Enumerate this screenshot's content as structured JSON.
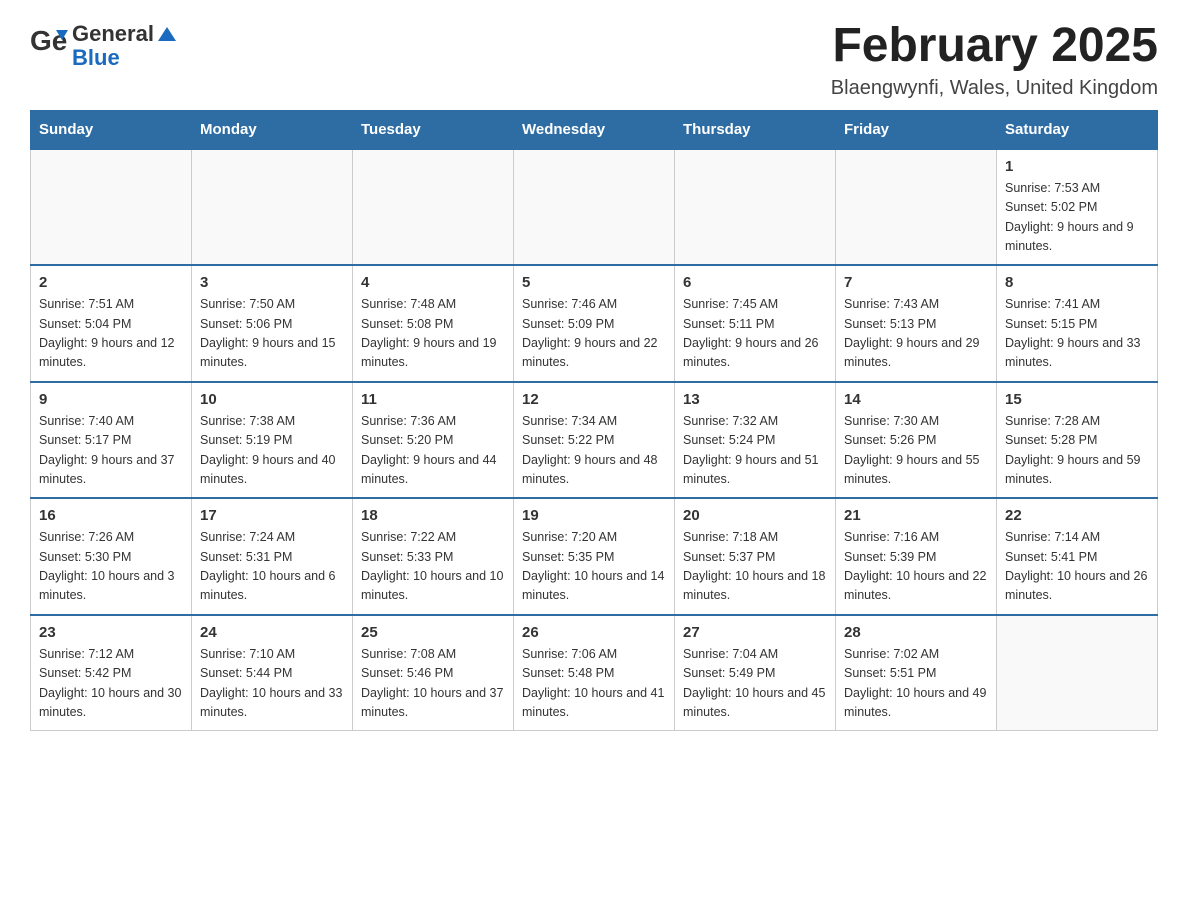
{
  "header": {
    "logo_general": "General",
    "logo_blue": "Blue",
    "month_title": "February 2025",
    "location": "Blaengwynfi, Wales, United Kingdom"
  },
  "weekdays": [
    "Sunday",
    "Monday",
    "Tuesday",
    "Wednesday",
    "Thursday",
    "Friday",
    "Saturday"
  ],
  "weeks": [
    [
      {
        "day": "",
        "sunrise": "",
        "sunset": "",
        "daylight": ""
      },
      {
        "day": "",
        "sunrise": "",
        "sunset": "",
        "daylight": ""
      },
      {
        "day": "",
        "sunrise": "",
        "sunset": "",
        "daylight": ""
      },
      {
        "day": "",
        "sunrise": "",
        "sunset": "",
        "daylight": ""
      },
      {
        "day": "",
        "sunrise": "",
        "sunset": "",
        "daylight": ""
      },
      {
        "day": "",
        "sunrise": "",
        "sunset": "",
        "daylight": ""
      },
      {
        "day": "1",
        "sunrise": "Sunrise: 7:53 AM",
        "sunset": "Sunset: 5:02 PM",
        "daylight": "Daylight: 9 hours and 9 minutes."
      }
    ],
    [
      {
        "day": "2",
        "sunrise": "Sunrise: 7:51 AM",
        "sunset": "Sunset: 5:04 PM",
        "daylight": "Daylight: 9 hours and 12 minutes."
      },
      {
        "day": "3",
        "sunrise": "Sunrise: 7:50 AM",
        "sunset": "Sunset: 5:06 PM",
        "daylight": "Daylight: 9 hours and 15 minutes."
      },
      {
        "day": "4",
        "sunrise": "Sunrise: 7:48 AM",
        "sunset": "Sunset: 5:08 PM",
        "daylight": "Daylight: 9 hours and 19 minutes."
      },
      {
        "day": "5",
        "sunrise": "Sunrise: 7:46 AM",
        "sunset": "Sunset: 5:09 PM",
        "daylight": "Daylight: 9 hours and 22 minutes."
      },
      {
        "day": "6",
        "sunrise": "Sunrise: 7:45 AM",
        "sunset": "Sunset: 5:11 PM",
        "daylight": "Daylight: 9 hours and 26 minutes."
      },
      {
        "day": "7",
        "sunrise": "Sunrise: 7:43 AM",
        "sunset": "Sunset: 5:13 PM",
        "daylight": "Daylight: 9 hours and 29 minutes."
      },
      {
        "day": "8",
        "sunrise": "Sunrise: 7:41 AM",
        "sunset": "Sunset: 5:15 PM",
        "daylight": "Daylight: 9 hours and 33 minutes."
      }
    ],
    [
      {
        "day": "9",
        "sunrise": "Sunrise: 7:40 AM",
        "sunset": "Sunset: 5:17 PM",
        "daylight": "Daylight: 9 hours and 37 minutes."
      },
      {
        "day": "10",
        "sunrise": "Sunrise: 7:38 AM",
        "sunset": "Sunset: 5:19 PM",
        "daylight": "Daylight: 9 hours and 40 minutes."
      },
      {
        "day": "11",
        "sunrise": "Sunrise: 7:36 AM",
        "sunset": "Sunset: 5:20 PM",
        "daylight": "Daylight: 9 hours and 44 minutes."
      },
      {
        "day": "12",
        "sunrise": "Sunrise: 7:34 AM",
        "sunset": "Sunset: 5:22 PM",
        "daylight": "Daylight: 9 hours and 48 minutes."
      },
      {
        "day": "13",
        "sunrise": "Sunrise: 7:32 AM",
        "sunset": "Sunset: 5:24 PM",
        "daylight": "Daylight: 9 hours and 51 minutes."
      },
      {
        "day": "14",
        "sunrise": "Sunrise: 7:30 AM",
        "sunset": "Sunset: 5:26 PM",
        "daylight": "Daylight: 9 hours and 55 minutes."
      },
      {
        "day": "15",
        "sunrise": "Sunrise: 7:28 AM",
        "sunset": "Sunset: 5:28 PM",
        "daylight": "Daylight: 9 hours and 59 minutes."
      }
    ],
    [
      {
        "day": "16",
        "sunrise": "Sunrise: 7:26 AM",
        "sunset": "Sunset: 5:30 PM",
        "daylight": "Daylight: 10 hours and 3 minutes."
      },
      {
        "day": "17",
        "sunrise": "Sunrise: 7:24 AM",
        "sunset": "Sunset: 5:31 PM",
        "daylight": "Daylight: 10 hours and 6 minutes."
      },
      {
        "day": "18",
        "sunrise": "Sunrise: 7:22 AM",
        "sunset": "Sunset: 5:33 PM",
        "daylight": "Daylight: 10 hours and 10 minutes."
      },
      {
        "day": "19",
        "sunrise": "Sunrise: 7:20 AM",
        "sunset": "Sunset: 5:35 PM",
        "daylight": "Daylight: 10 hours and 14 minutes."
      },
      {
        "day": "20",
        "sunrise": "Sunrise: 7:18 AM",
        "sunset": "Sunset: 5:37 PM",
        "daylight": "Daylight: 10 hours and 18 minutes."
      },
      {
        "day": "21",
        "sunrise": "Sunrise: 7:16 AM",
        "sunset": "Sunset: 5:39 PM",
        "daylight": "Daylight: 10 hours and 22 minutes."
      },
      {
        "day": "22",
        "sunrise": "Sunrise: 7:14 AM",
        "sunset": "Sunset: 5:41 PM",
        "daylight": "Daylight: 10 hours and 26 minutes."
      }
    ],
    [
      {
        "day": "23",
        "sunrise": "Sunrise: 7:12 AM",
        "sunset": "Sunset: 5:42 PM",
        "daylight": "Daylight: 10 hours and 30 minutes."
      },
      {
        "day": "24",
        "sunrise": "Sunrise: 7:10 AM",
        "sunset": "Sunset: 5:44 PM",
        "daylight": "Daylight: 10 hours and 33 minutes."
      },
      {
        "day": "25",
        "sunrise": "Sunrise: 7:08 AM",
        "sunset": "Sunset: 5:46 PM",
        "daylight": "Daylight: 10 hours and 37 minutes."
      },
      {
        "day": "26",
        "sunrise": "Sunrise: 7:06 AM",
        "sunset": "Sunset: 5:48 PM",
        "daylight": "Daylight: 10 hours and 41 minutes."
      },
      {
        "day": "27",
        "sunrise": "Sunrise: 7:04 AM",
        "sunset": "Sunset: 5:49 PM",
        "daylight": "Daylight: 10 hours and 45 minutes."
      },
      {
        "day": "28",
        "sunrise": "Sunrise: 7:02 AM",
        "sunset": "Sunset: 5:51 PM",
        "daylight": "Daylight: 10 hours and 49 minutes."
      },
      {
        "day": "",
        "sunrise": "",
        "sunset": "",
        "daylight": ""
      }
    ]
  ]
}
